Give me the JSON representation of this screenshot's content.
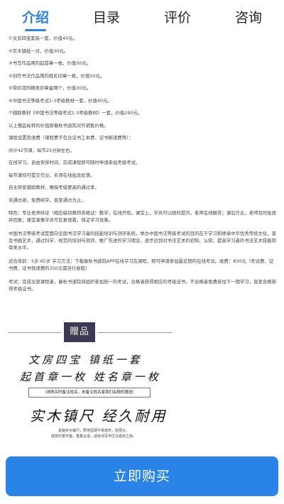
{
  "tabs": [
    {
      "label": "介绍",
      "active": true
    },
    {
      "label": "目录",
      "active": false
    },
    {
      "label": "评价",
      "active": false
    },
    {
      "label": "咨询",
      "active": false
    }
  ],
  "content_lines": [
    "①文房四宝套装一套，价值40元。",
    "②实木镇纸一对，价值30元。",
    "③书写作品用的起首章一枚，价值50元。",
    "④创作书法作品用的姓名印章一枚，价值50元。",
    "⑤带印泥的精美印章盒两个，价值30元。",
    "⑥中国书法等级考试1-3考级教材一套，价值40元。",
    "⑦辅助教材《中国书法等级考试1-3考级教材》一套，价值290元。",
    "以上赠品标称的价值即春秋书道院对外销售价格。",
    "课程设置及收费（课程费不包含证书工本费、证书邮递费等）：",
    "共计42节课，每节25分钟左右。",
    "在线学习，自由安排时间，完成课程即可随时申请参加考级考试。",
    "每节课均可提交作业，名师在线批改反馈。",
    "自主研发辅助教材，确保考级更高的通过率。",
    "未通过者，免费续学，直至通过为止。"
  ],
  "content_paras": [
    "特色：专业老师持证（相应级别教师资格证）教学，在线开班。课堂上，学员可以随时提问，老师在线解答；课后作业，老师及时批改并回复；课堂录像学员可反复观看，保证学习效果。",
    "中国书法等级考试是面向全国书法学习者的技能培训与测评系统，举办中国书法等级考试的目的在于学习和继承中华优秀传统文化，普及书画艺术，通过科学、规范的培训与测评，推广先进的学习理念，逐步达到对书法艺术的初知、认知，提高学习者的书法艺术技能和审美水平。",
    "适合年龄：5岁-65岁 学习方法：下载春秋书道院APP在线学习完课程，即可申请参加最近期的在线考试。收费：830元（考试费、证书费、证书快递费的350元需另行收取）",
    "考试：完成全部课程者，春秋书道院将组织参加统一的考试，合格者获得相应的考级证书，不合格者免费参加下一期学习，直至合格获得考级证书。"
  ],
  "promo": {
    "seal_text": "赠品",
    "line1": "文房四宝   镇纸一套",
    "line2": "起首章一枚   姓名章一枚",
    "note_box": "（请购买时备注姓名，未备注姓名者我们会随机赠送）",
    "headline": "实木镇尺  经久耐用",
    "small_note_1": "素面实木镇尺，质地坚硬不易变形，轻便大。",
    "small_note_2": "底部打磨平整，重量合适，适用书写中压住纸张之用。"
  },
  "buy_button": {
    "label": "立即购买"
  },
  "colors": {
    "accent": "#2a83e6",
    "seal_bg": "#3a3a55"
  }
}
